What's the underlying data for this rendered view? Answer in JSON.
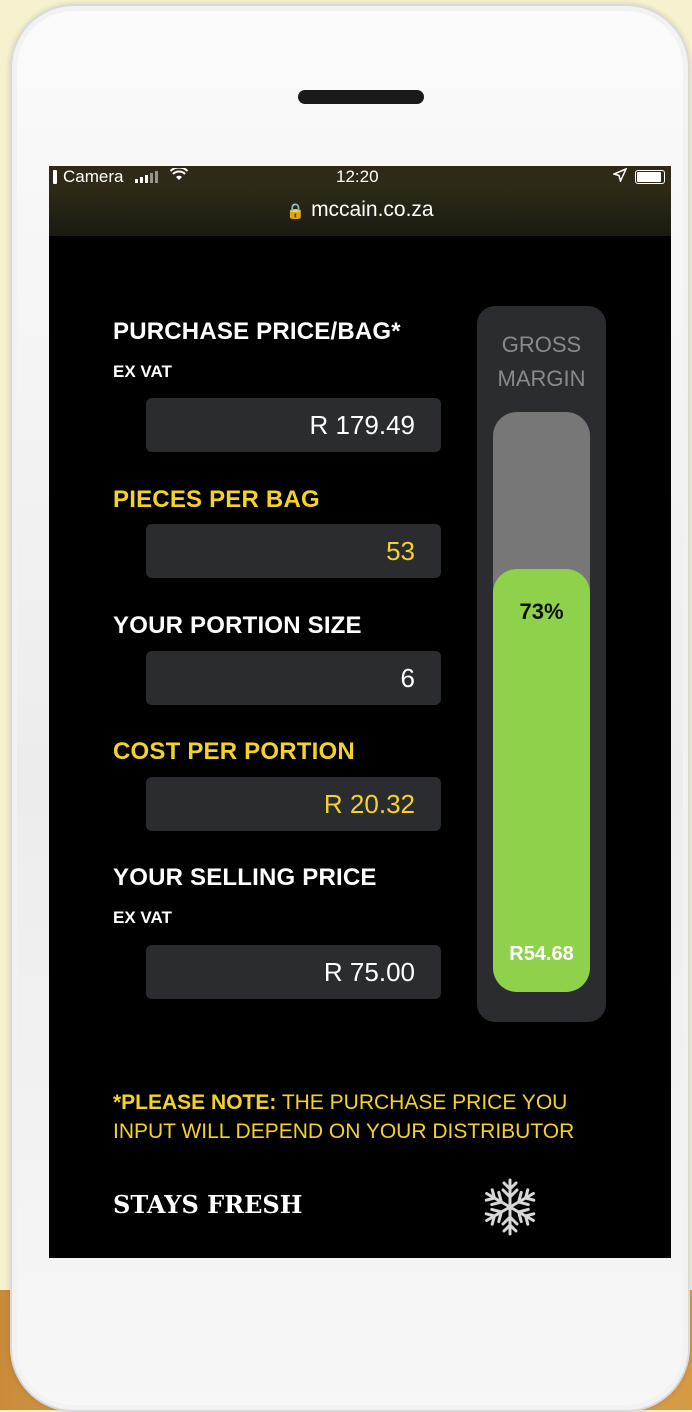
{
  "status_bar": {
    "carrier": "Camera",
    "time": "12:20",
    "signal_icon": "signal-icon",
    "wifi_icon": "wifi-icon",
    "location_icon": "location-arrow-icon",
    "battery_icon": "battery-icon"
  },
  "browser": {
    "url": "mccain.co.za",
    "lock_icon": "lock-icon"
  },
  "calculator": {
    "purchase_price_label": "PURCHASE PRICE/BAG*",
    "purchase_price_sublabel": "EX VAT",
    "purchase_price_value": "R 179.49",
    "pieces_per_bag_label": "PIECES PER BAG",
    "pieces_per_bag_value": "53",
    "portion_size_label": "YOUR PORTION SIZE",
    "portion_size_value": "6",
    "cost_per_portion_label": "COST PER PORTION",
    "cost_per_portion_value": "R 20.32",
    "selling_price_label": "YOUR SELLING PRICE",
    "selling_price_sublabel": "EX VAT",
    "selling_price_value": "R 75.00"
  },
  "gross_margin": {
    "title_line1": "GROSS",
    "title_line2": "MARGIN",
    "percent_text": "73%",
    "percent_value": 73,
    "amount_text": "R54.68"
  },
  "note": {
    "bold": "*PLEASE NOTE:",
    "text": " THE PURCHASE PRICE YOU INPUT WILL DEPEND ON YOUR DISTRIBUTOR"
  },
  "footer": {
    "text": "STAYS FRESH",
    "icon": "snowflake-icon"
  },
  "colors": {
    "accent_yellow": "#f5d22a",
    "margin_green": "#8ed14b",
    "field_bg": "#2b2c30"
  }
}
